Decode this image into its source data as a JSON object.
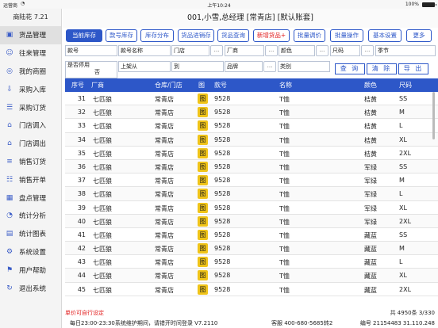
{
  "status_bar": {
    "carrier": "运营商",
    "wifi_icon": "wifi-icon",
    "time": "上午10:24",
    "battery": "100%"
  },
  "sidebar": {
    "app_title": "商陆花 7.21",
    "items": [
      {
        "label": "货品管理",
        "icon": "box-icon",
        "active": true
      },
      {
        "label": "往来管理",
        "icon": "people-icon"
      },
      {
        "label": "我的商圈",
        "icon": "circle-icon"
      },
      {
        "label": "采购入库",
        "icon": "truck-in-icon"
      },
      {
        "label": "采购订货",
        "icon": "order-icon"
      },
      {
        "label": "门店调入",
        "icon": "store-in-icon"
      },
      {
        "label": "门店调出",
        "icon": "store-out-icon"
      },
      {
        "label": "销售订货",
        "icon": "sale-order-icon"
      },
      {
        "label": "销售开单",
        "icon": "sale-bill-icon"
      },
      {
        "label": "盘点管理",
        "icon": "inventory-icon"
      },
      {
        "label": "统计分析",
        "icon": "stats-icon"
      },
      {
        "label": "统计图表",
        "icon": "chart-icon"
      },
      {
        "label": "系统设置",
        "icon": "gear-icon"
      },
      {
        "label": "用户帮助",
        "icon": "help-icon"
      },
      {
        "label": "退出系统",
        "icon": "exit-icon"
      }
    ]
  },
  "header": {
    "title": "001,小雪,总经理 [常青店] [默认账套]"
  },
  "toolbar": {
    "buttons": [
      {
        "label": "当前库存",
        "active": true
      },
      {
        "label": "款号库存"
      },
      {
        "label": "库存分布"
      },
      {
        "label": "货品进销存"
      },
      {
        "label": "货品查询"
      },
      {
        "label": "新增货品+",
        "danger": true
      },
      {
        "label": "批量调价"
      },
      {
        "label": "批量操作"
      },
      {
        "label": "基本设置"
      },
      {
        "label": "更多"
      }
    ]
  },
  "filters": {
    "code": "款号",
    "code_name": "款号名称",
    "store": "门店",
    "vendor": "厂商",
    "color": "颜色",
    "size": "尺码",
    "season": "季节",
    "discontinued": "是否停用",
    "discontinued_value": "否",
    "listed_from": "上架从",
    "to": "到",
    "brand": "品牌",
    "category": "类别",
    "dots": "...",
    "query_btn": "查 询",
    "clear_btn": "清 除",
    "export_btn": "导 出"
  },
  "table": {
    "headers": [
      "序号",
      "厂商",
      "仓库/门店",
      "图",
      "款号",
      "名称",
      "颜色",
      "尺码"
    ],
    "rows": [
      {
        "no": "31",
        "vendor": "七匹狼",
        "store": "常青店",
        "pic": "图",
        "code": "9528",
        "name": "T恤",
        "color": "桔黄",
        "size": "SS"
      },
      {
        "no": "32",
        "vendor": "七匹狼",
        "store": "常青店",
        "pic": "图",
        "code": "9528",
        "name": "T恤",
        "color": "桔黄",
        "size": "M"
      },
      {
        "no": "33",
        "vendor": "七匹狼",
        "store": "常青店",
        "pic": "图",
        "code": "9528",
        "name": "T恤",
        "color": "桔黄",
        "size": "L"
      },
      {
        "no": "34",
        "vendor": "七匹狼",
        "store": "常青店",
        "pic": "图",
        "code": "9528",
        "name": "T恤",
        "color": "桔黄",
        "size": "XL"
      },
      {
        "no": "35",
        "vendor": "七匹狼",
        "store": "常青店",
        "pic": "图",
        "code": "9528",
        "name": "T恤",
        "color": "桔黄",
        "size": "2XL"
      },
      {
        "no": "36",
        "vendor": "七匹狼",
        "store": "常青店",
        "pic": "图",
        "code": "9528",
        "name": "T恤",
        "color": "军绿",
        "size": "SS"
      },
      {
        "no": "37",
        "vendor": "七匹狼",
        "store": "常青店",
        "pic": "图",
        "code": "9528",
        "name": "T恤",
        "color": "军绿",
        "size": "M"
      },
      {
        "no": "38",
        "vendor": "七匹狼",
        "store": "常青店",
        "pic": "图",
        "code": "9528",
        "name": "T恤",
        "color": "军绿",
        "size": "L"
      },
      {
        "no": "39",
        "vendor": "七匹狼",
        "store": "常青店",
        "pic": "图",
        "code": "9528",
        "name": "T恤",
        "color": "军绿",
        "size": "XL"
      },
      {
        "no": "40",
        "vendor": "七匹狼",
        "store": "常青店",
        "pic": "图",
        "code": "9528",
        "name": "T恤",
        "color": "军绿",
        "size": "2XL"
      },
      {
        "no": "41",
        "vendor": "七匹狼",
        "store": "常青店",
        "pic": "图",
        "code": "9528",
        "name": "T恤",
        "color": "藏蓝",
        "size": "SS"
      },
      {
        "no": "42",
        "vendor": "七匹狼",
        "store": "常青店",
        "pic": "图",
        "code": "9528",
        "name": "T恤",
        "color": "藏蓝",
        "size": "M"
      },
      {
        "no": "43",
        "vendor": "七匹狼",
        "store": "常青店",
        "pic": "图",
        "code": "9528",
        "name": "T恤",
        "color": "藏蓝",
        "size": "L"
      },
      {
        "no": "44",
        "vendor": "七匹狼",
        "store": "常青店",
        "pic": "图",
        "code": "9528",
        "name": "T恤",
        "color": "藏蓝",
        "size": "XL"
      },
      {
        "no": "45",
        "vendor": "七匹狼",
        "store": "常青店",
        "pic": "图",
        "code": "9528",
        "name": "T恤",
        "color": "藏蓝",
        "size": "2XL"
      }
    ]
  },
  "footer": {
    "note": "单价可自行设定",
    "total": "共 4950条  3/330",
    "maintenance": "每日23:00-23:30系统维护期间，请错开时间登录  V7.2110",
    "service": "客服 400-680-5685转2",
    "serial": "编号 21154483  31.110.248"
  },
  "colors": {
    "accent": "#2d57c8",
    "danger": "#e21b1b",
    "thumb": "#f0c419"
  }
}
